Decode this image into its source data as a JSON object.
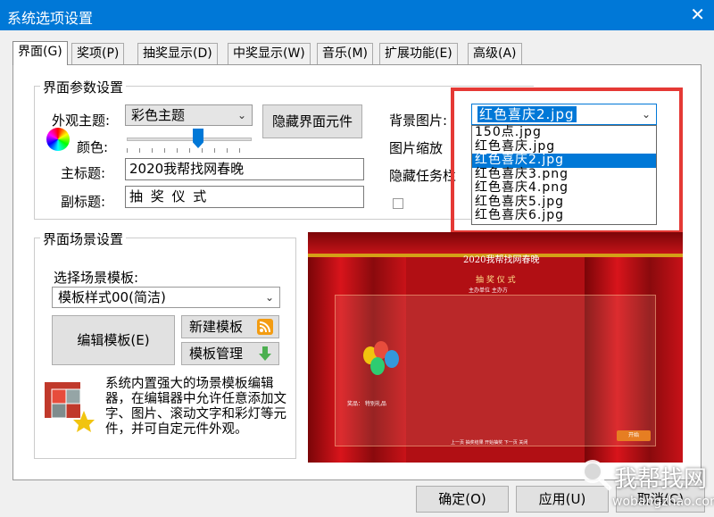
{
  "window": {
    "title": "系统选项设置",
    "close": "✕"
  },
  "tabs": [
    "界面(G)",
    "奖项(P)",
    "抽奖显示(D)",
    "中奖显示(W)",
    "音乐(M)",
    "扩展功能(E)",
    "高级(A)"
  ],
  "interface_params": {
    "group_title": "界面参数设置",
    "theme_label": "外观主题:",
    "theme_value": "彩色主题",
    "color_label": "颜色:",
    "hide_elements_button": "隐藏界面元件",
    "main_title_label": "主标题:",
    "main_title_value": "2020我帮找网春晚",
    "subtitle_label": "副标题:",
    "subtitle_value": "抽 奖 仪 式",
    "bg_image_label": "背景图片:",
    "bg_image_value": "红色喜庆2.jpg",
    "image_scale_label": "图片缩放",
    "hide_taskbar_label": "隐藏任务栏",
    "bg_options": [
      "150点.jpg",
      "红色喜庆.jpg",
      "红色喜庆2.jpg",
      "红色喜庆3.png",
      "红色喜庆4.png",
      "红色喜庆5.jpg",
      "红色喜庆6.jpg"
    ],
    "bg_selected_index": 2
  },
  "scene": {
    "group_title": "界面场景设置",
    "template_label": "选择场景模板:",
    "template_value": "模板样式00(简洁)",
    "edit_button": "编辑模板(E)",
    "new_button": "新建模板",
    "manage_button": "模板管理",
    "description": "系统内置强大的场景模板编辑器，在编辑器中允许任意添加文字、图片、滚动文字和彩灯等元件，并可自定元件外观。"
  },
  "preview": {
    "title": "2020我帮找网春晚",
    "subtitle": "抽 奖 仪 式",
    "small_text": "主办单位 主办方",
    "prize_text": "奖品：  特别礼品",
    "bottom_text": "上一页 抽奖结果 开始抽奖 下一页 关闭",
    "start_button": "开始"
  },
  "footer": {
    "ok": "确定(O)",
    "apply": "应用(U)",
    "cancel": "取消(C)"
  },
  "watermark": {
    "text": "我帮找网",
    "url": "wobangzhao.com"
  },
  "colors": {
    "titlebar": "#0078d7",
    "highlight": "#0078d7",
    "callout": "#e53935",
    "preview_bg": "#b10f14"
  }
}
